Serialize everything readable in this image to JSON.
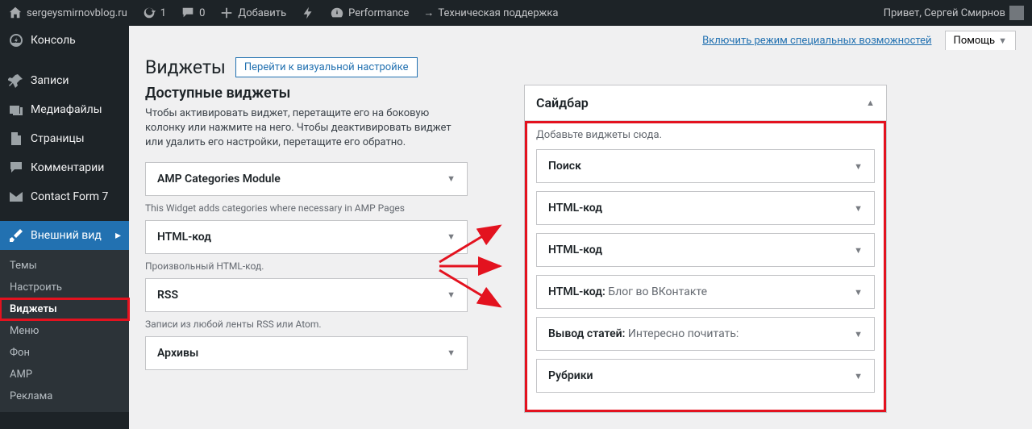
{
  "admin_bar": {
    "site_name": "sergeysmirnovblog.ru",
    "refresh_count": "1",
    "comments_count": "0",
    "add_new": "Добавить",
    "performance": "Performance",
    "support": "Техническая поддержка",
    "greeting": "Привет, Сергей Смирнов"
  },
  "sidebar_menu": {
    "dashboard": "Консоль",
    "posts": "Записи",
    "media": "Медиафайлы",
    "pages": "Страницы",
    "comments": "Комментарии",
    "contact_form": "Contact Form 7",
    "appearance": "Внешний вид",
    "submenu": {
      "themes": "Темы",
      "customize": "Настроить",
      "widgets": "Виджеты",
      "menus": "Меню",
      "background": "Фон",
      "amp": "AMP",
      "ads": "Реклама"
    }
  },
  "screen": {
    "accessibility": "Включить режим специальных возможностей",
    "help": "Помощь"
  },
  "page": {
    "title": "Виджеты",
    "action": "Перейти к визуальной настройке",
    "available_heading": "Доступные виджеты",
    "available_desc": "Чтобы активировать виджет, перетащите его на боковую колонку или нажмите на него. Чтобы деактивировать виджет или удалить его настройки, перетащите его обратно."
  },
  "available_widgets": [
    {
      "title": "AMP Categories Module",
      "desc": "This Widget adds categories where necessary in AMP Pages"
    },
    {
      "title": "HTML-код",
      "desc": "Произвольный HTML-код."
    },
    {
      "title": "RSS",
      "desc": "Записи из любой ленты RSS или Atom."
    },
    {
      "title": "Архивы",
      "desc": ""
    }
  ],
  "sidebar_area": {
    "title": "Сайдбар",
    "hint": "Добавьте виджеты сюда.",
    "widgets": [
      {
        "title": "Поиск",
        "suffix": ""
      },
      {
        "title": "HTML-код",
        "suffix": ""
      },
      {
        "title": "HTML-код",
        "suffix": ""
      },
      {
        "title": "HTML-код:",
        "suffix": " Блог во ВКонтакте"
      },
      {
        "title": "Вывод статей:",
        "suffix": " Интересно почитать:"
      },
      {
        "title": "Рубрики",
        "suffix": ""
      }
    ]
  }
}
